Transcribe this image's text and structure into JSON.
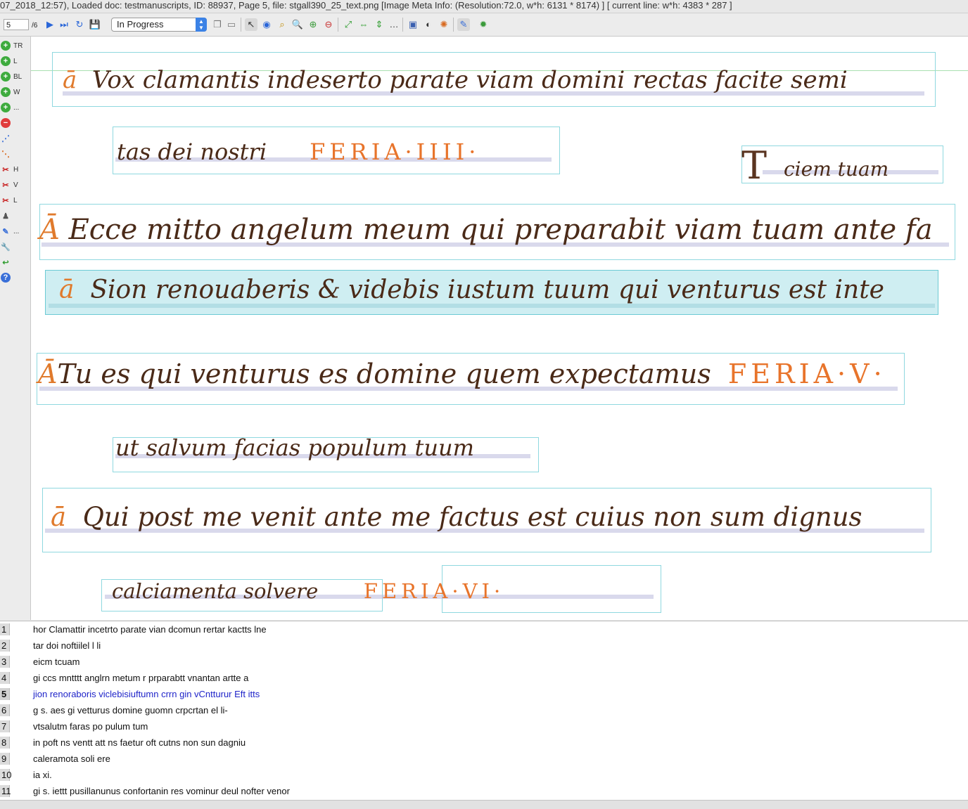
{
  "titlebar": {
    "text": "07_2018_12:57), Loaded doc: testmanuscripts, ID: 88937, Page 5, file: stgall390_25_text.png [Image Meta Info: (Resolution:72.0, w*h: 6131 * 8174) ] [ current line: w*h: 4383 * 287 ]"
  },
  "toolbar": {
    "page_value": "5",
    "page_total": "/6",
    "status_value": "In Progress"
  },
  "leftbar": {
    "items": [
      {
        "label": "TR",
        "icon": "plus-circle-icon"
      },
      {
        "label": "L",
        "icon": "plus-circle-icon"
      },
      {
        "label": "BL",
        "icon": "plus-circle-icon"
      },
      {
        "label": "W",
        "icon": "plus-circle-icon"
      },
      {
        "label": "...",
        "icon": "plus-circle-icon"
      },
      {
        "label": "",
        "icon": "minus-circle-icon"
      },
      {
        "label": "",
        "icon": "add-point-icon"
      },
      {
        "label": "",
        "icon": "remove-point-icon"
      },
      {
        "label": "H",
        "icon": "scissors-icon"
      },
      {
        "label": "V",
        "icon": "scissors-icon"
      },
      {
        "label": "L",
        "icon": "scissors-icon"
      },
      {
        "label": "",
        "icon": "person-icon"
      },
      {
        "label": "...",
        "icon": "edit-icon"
      },
      {
        "label": "",
        "icon": "wrench-icon"
      },
      {
        "label": "",
        "icon": "undo-icon"
      },
      {
        "label": "",
        "icon": "help-icon"
      }
    ]
  },
  "transcript": {
    "lines": [
      {
        "num": "1",
        "text": " hor Clamattir incetrto parate vian dcomun rertar kactts lne",
        "active": false
      },
      {
        "num": "2",
        "text": "tar doi noftiilel l li",
        "active": false
      },
      {
        "num": "3",
        "text": "eicm tcuam",
        "active": false
      },
      {
        "num": "4",
        "text": "gi ccs mntttt anglrn metum r prparabtt vnantan artte a",
        "active": false
      },
      {
        "num": "5",
        "text": " jion renoraboris viclebisiuftumn crrn gin vCntturur Eft itts",
        "active": true
      },
      {
        "num": "6",
        "text": "g s. aes gi vetturus domine guomn crpcrtan el li-",
        "active": false
      },
      {
        "num": "7",
        "text": "vtsalutm faras po pulum tum",
        "active": false
      },
      {
        "num": "8",
        "text": " in poft ns ventt att ns faetur oft cutns non sun dagniu",
        "active": false
      },
      {
        "num": "9",
        "text": "caleramota soli ere",
        "active": false
      },
      {
        "num": "10",
        "text": "ia xi.",
        "active": false
      },
      {
        "num": "11",
        "text": "gi s. iettt pusillanunus confortanin res vominur deul nofter venor",
        "active": false
      }
    ]
  },
  "manuscript": {
    "lines": [
      {
        "initial": "ā",
        "text": "Vox clamantis indeserto parate viam domini rectas facite semi"
      },
      {
        "initial": "",
        "text": "tas dei nostri",
        "feria": "FERIA·IIII·"
      },
      {
        "initial": "",
        "text": "ciem tuam"
      },
      {
        "initial": "Ā",
        "text": "Ecce mitto angelum meum qui preparabit viam tuam ante fa"
      },
      {
        "initial": "ā",
        "text": "Sion renouaberis & videbis iustum tuum qui venturus est inte"
      },
      {
        "initial": "Ā",
        "text": "Tu es qui venturus es domine quem expectamus",
        "feria": "FERIA·V·"
      },
      {
        "initial": "",
        "text": "ut salvum facias populum tuum"
      },
      {
        "initial": "ā",
        "text": "Qui post me venit ante me factus est cuius non sum dignus"
      },
      {
        "initial": "",
        "text": "calciamenta solvere",
        "feria": "FERIA·VI·"
      }
    ]
  }
}
